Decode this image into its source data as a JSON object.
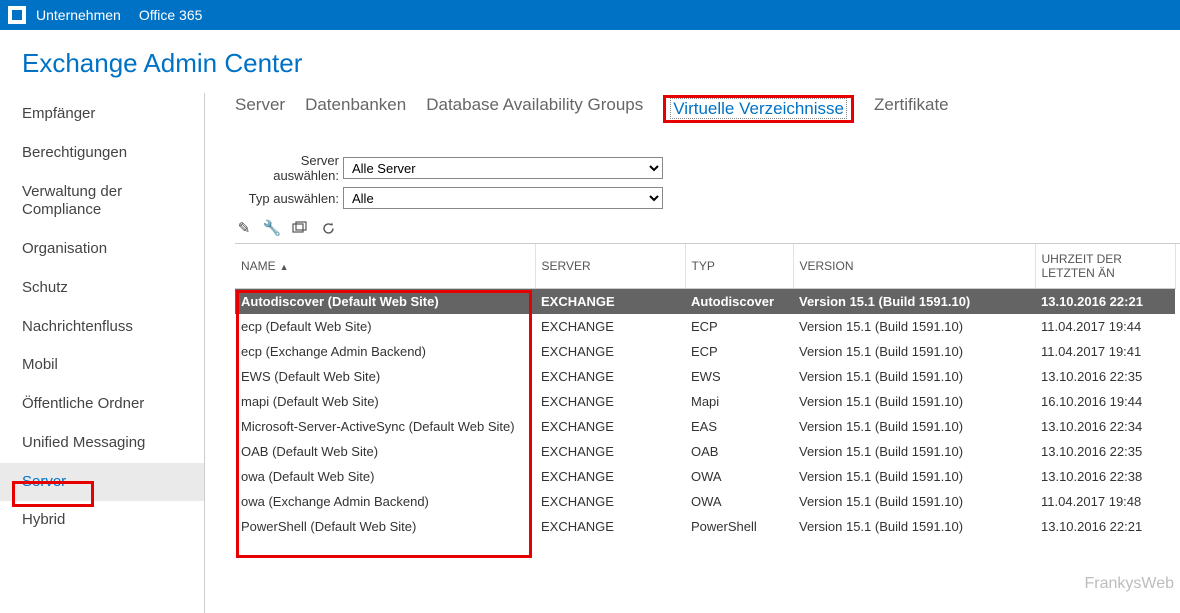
{
  "topbar": {
    "company": "Unternehmen",
    "office": "Office 365"
  },
  "pageTitle": "Exchange Admin Center",
  "sidebar": {
    "items": [
      {
        "label": "Empfänger"
      },
      {
        "label": "Berechtigungen"
      },
      {
        "label": "Verwaltung der Compliance"
      },
      {
        "label": "Organisation"
      },
      {
        "label": "Schutz"
      },
      {
        "label": "Nachrichtenfluss"
      },
      {
        "label": "Mobil"
      },
      {
        "label": "Öffentliche Ordner"
      },
      {
        "label": "Unified Messaging"
      },
      {
        "label": "Server"
      },
      {
        "label": "Hybrid"
      }
    ]
  },
  "tabs": {
    "items": [
      {
        "label": "Server"
      },
      {
        "label": "Datenbanken"
      },
      {
        "label": "Database Availability Groups"
      },
      {
        "label": "Virtuelle Verzeichnisse"
      },
      {
        "label": "Zertifikate"
      }
    ]
  },
  "filters": {
    "serverLabel": "Server auswählen:",
    "serverValue": "Alle Server",
    "typeLabel": "Typ auswählen:",
    "typeValue": "Alle"
  },
  "columns": {
    "name": "NAME",
    "server": "SERVER",
    "typ": "TYP",
    "version": "VERSION",
    "time": "UHRZEIT DER LETZTEN ÄN"
  },
  "rows": [
    {
      "name": "Autodiscover (Default Web Site)",
      "server": "EXCHANGE",
      "typ": "Autodiscover",
      "version": "Version 15.1 (Build 1591.10)",
      "time": "13.10.2016 22:21",
      "selected": true
    },
    {
      "name": "ecp (Default Web Site)",
      "server": "EXCHANGE",
      "typ": "ECP",
      "version": "Version 15.1 (Build 1591.10)",
      "time": "11.04.2017 19:44"
    },
    {
      "name": "ecp (Exchange Admin Backend)",
      "server": "EXCHANGE",
      "typ": "ECP",
      "version": "Version 15.1 (Build 1591.10)",
      "time": "11.04.2017 19:41"
    },
    {
      "name": "EWS (Default Web Site)",
      "server": "EXCHANGE",
      "typ": "EWS",
      "version": "Version 15.1 (Build 1591.10)",
      "time": "13.10.2016 22:35"
    },
    {
      "name": "mapi (Default Web Site)",
      "server": "EXCHANGE",
      "typ": "Mapi",
      "version": "Version 15.1 (Build 1591.10)",
      "time": "16.10.2016 19:44"
    },
    {
      "name": "Microsoft-Server-ActiveSync (Default Web Site)",
      "server": "EXCHANGE",
      "typ": "EAS",
      "version": "Version 15.1 (Build 1591.10)",
      "time": "13.10.2016 22:34"
    },
    {
      "name": "OAB (Default Web Site)",
      "server": "EXCHANGE",
      "typ": "OAB",
      "version": "Version 15.1 (Build 1591.10)",
      "time": "13.10.2016 22:35"
    },
    {
      "name": "owa (Default Web Site)",
      "server": "EXCHANGE",
      "typ": "OWA",
      "version": "Version 15.1 (Build 1591.10)",
      "time": "13.10.2016 22:38"
    },
    {
      "name": "owa (Exchange Admin Backend)",
      "server": "EXCHANGE",
      "typ": "OWA",
      "version": "Version 15.1 (Build 1591.10)",
      "time": "11.04.2017 19:48"
    },
    {
      "name": "PowerShell (Default Web Site)",
      "server": "EXCHANGE",
      "typ": "PowerShell",
      "version": "Version 15.1 (Build 1591.10)",
      "time": "13.10.2016 22:21"
    }
  ],
  "watermark": "FrankysWeb"
}
